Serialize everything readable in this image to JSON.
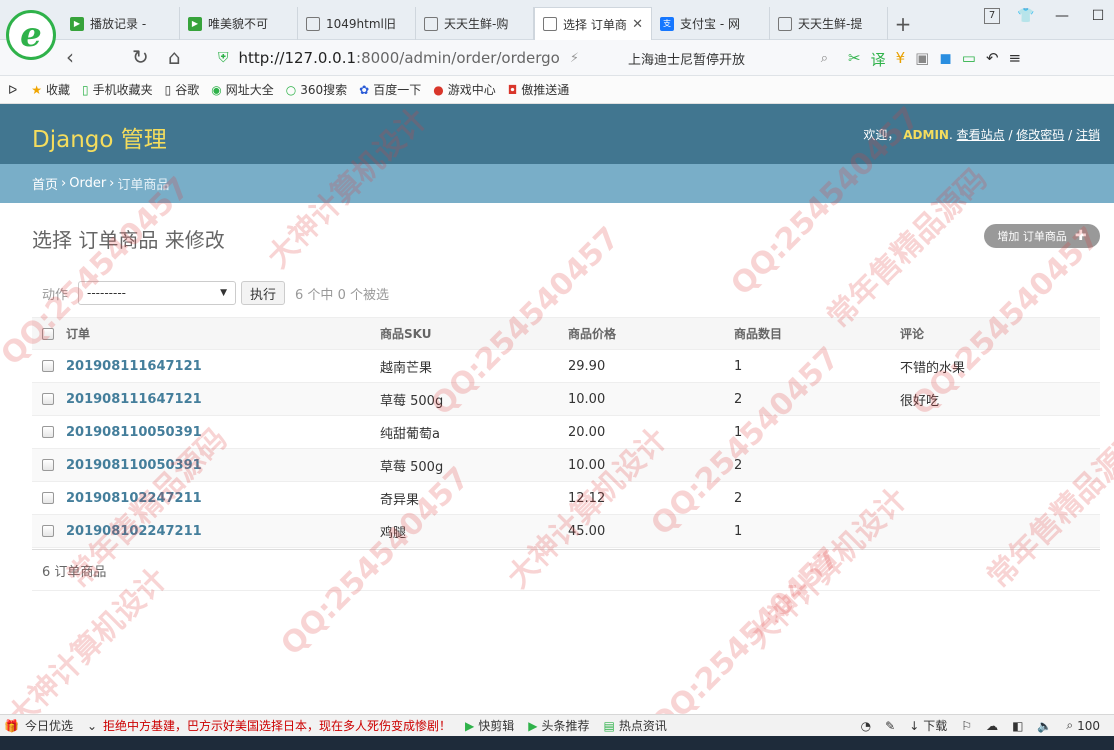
{
  "browser": {
    "logo_glyph": "e",
    "tabs": [
      {
        "title": "播放记录 -",
        "icon_color": "#37a33b",
        "active": false
      },
      {
        "title": "唯美貌不可",
        "icon_color": "#37a33b",
        "active": false
      },
      {
        "title": "1049html旧",
        "icon_color": "#ffffff",
        "active": false
      },
      {
        "title": "天天生鲜-购",
        "icon_color": "#ffffff",
        "active": false
      },
      {
        "title": "选择 订单商",
        "icon_color": "#ffffff",
        "active": true
      },
      {
        "title": "支付宝 - 网",
        "icon_color": "#1677ff",
        "active": false
      },
      {
        "title": "天天生鲜-提",
        "icon_color": "#ffffff",
        "active": false
      }
    ],
    "tab_count": "7",
    "url_host": "http://127.0.0.1",
    "url_path": ":8000/admin/order/ordergo",
    "search_text": "上海迪士尼暂停开放",
    "bookmarks": [
      "收藏",
      "手机收藏夹",
      "谷歌",
      "网址大全",
      "360搜索",
      "百度一下",
      "游戏中心",
      "傲推送通"
    ]
  },
  "admin": {
    "brand": "Django 管理",
    "welcome": "欢迎，",
    "user": "ADMIN",
    "view_site": "查看站点",
    "change_password": "修改密码",
    "logout": "注销",
    "breadcrumb": {
      "home": "首页",
      "app": "Order",
      "current": "订单商品"
    },
    "title": "选择 订单商品 来修改",
    "add_button": "增加 订单商品",
    "action_label": "动作",
    "action_selected": "---------",
    "go_button": "执行",
    "selection_counter": "6 个中 0 个被选",
    "columns": [
      "订单",
      "商品SKU",
      "商品价格",
      "商品数目",
      "评论"
    ],
    "rows": [
      {
        "order": "201908111647121",
        "sku": "越南芒果",
        "price": "29.90",
        "count": "1",
        "comment": "不错的水果"
      },
      {
        "order": "201908111647121",
        "sku": "草莓 500g",
        "price": "10.00",
        "count": "2",
        "comment": "很好吃"
      },
      {
        "order": "201908110050391",
        "sku": "纯甜葡萄a",
        "price": "20.00",
        "count": "1",
        "comment": ""
      },
      {
        "order": "201908110050391",
        "sku": "草莓 500g",
        "price": "10.00",
        "count": "2",
        "comment": ""
      },
      {
        "order": "201908102247211",
        "sku": "奇异果",
        "price": "12.12",
        "count": "2",
        "comment": ""
      },
      {
        "order": "201908102247211",
        "sku": "鸡腿",
        "price": "45.00",
        "count": "1",
        "comment": ""
      }
    ],
    "paginator": "6 订单商品"
  },
  "watermark_texts": [
    "QQ:254540457",
    "常年售精品源码",
    "大神计算机设计"
  ],
  "statusbar": {
    "today": "今日优选",
    "headline": "拒绝中方基建，巴方示好美国选择日本，现在多人死伤变成惨剧！",
    "kuaijian": "快剪辑",
    "toutiao": "头条推荐",
    "hot": "热点资讯",
    "download": "下载",
    "zoom": "100"
  }
}
